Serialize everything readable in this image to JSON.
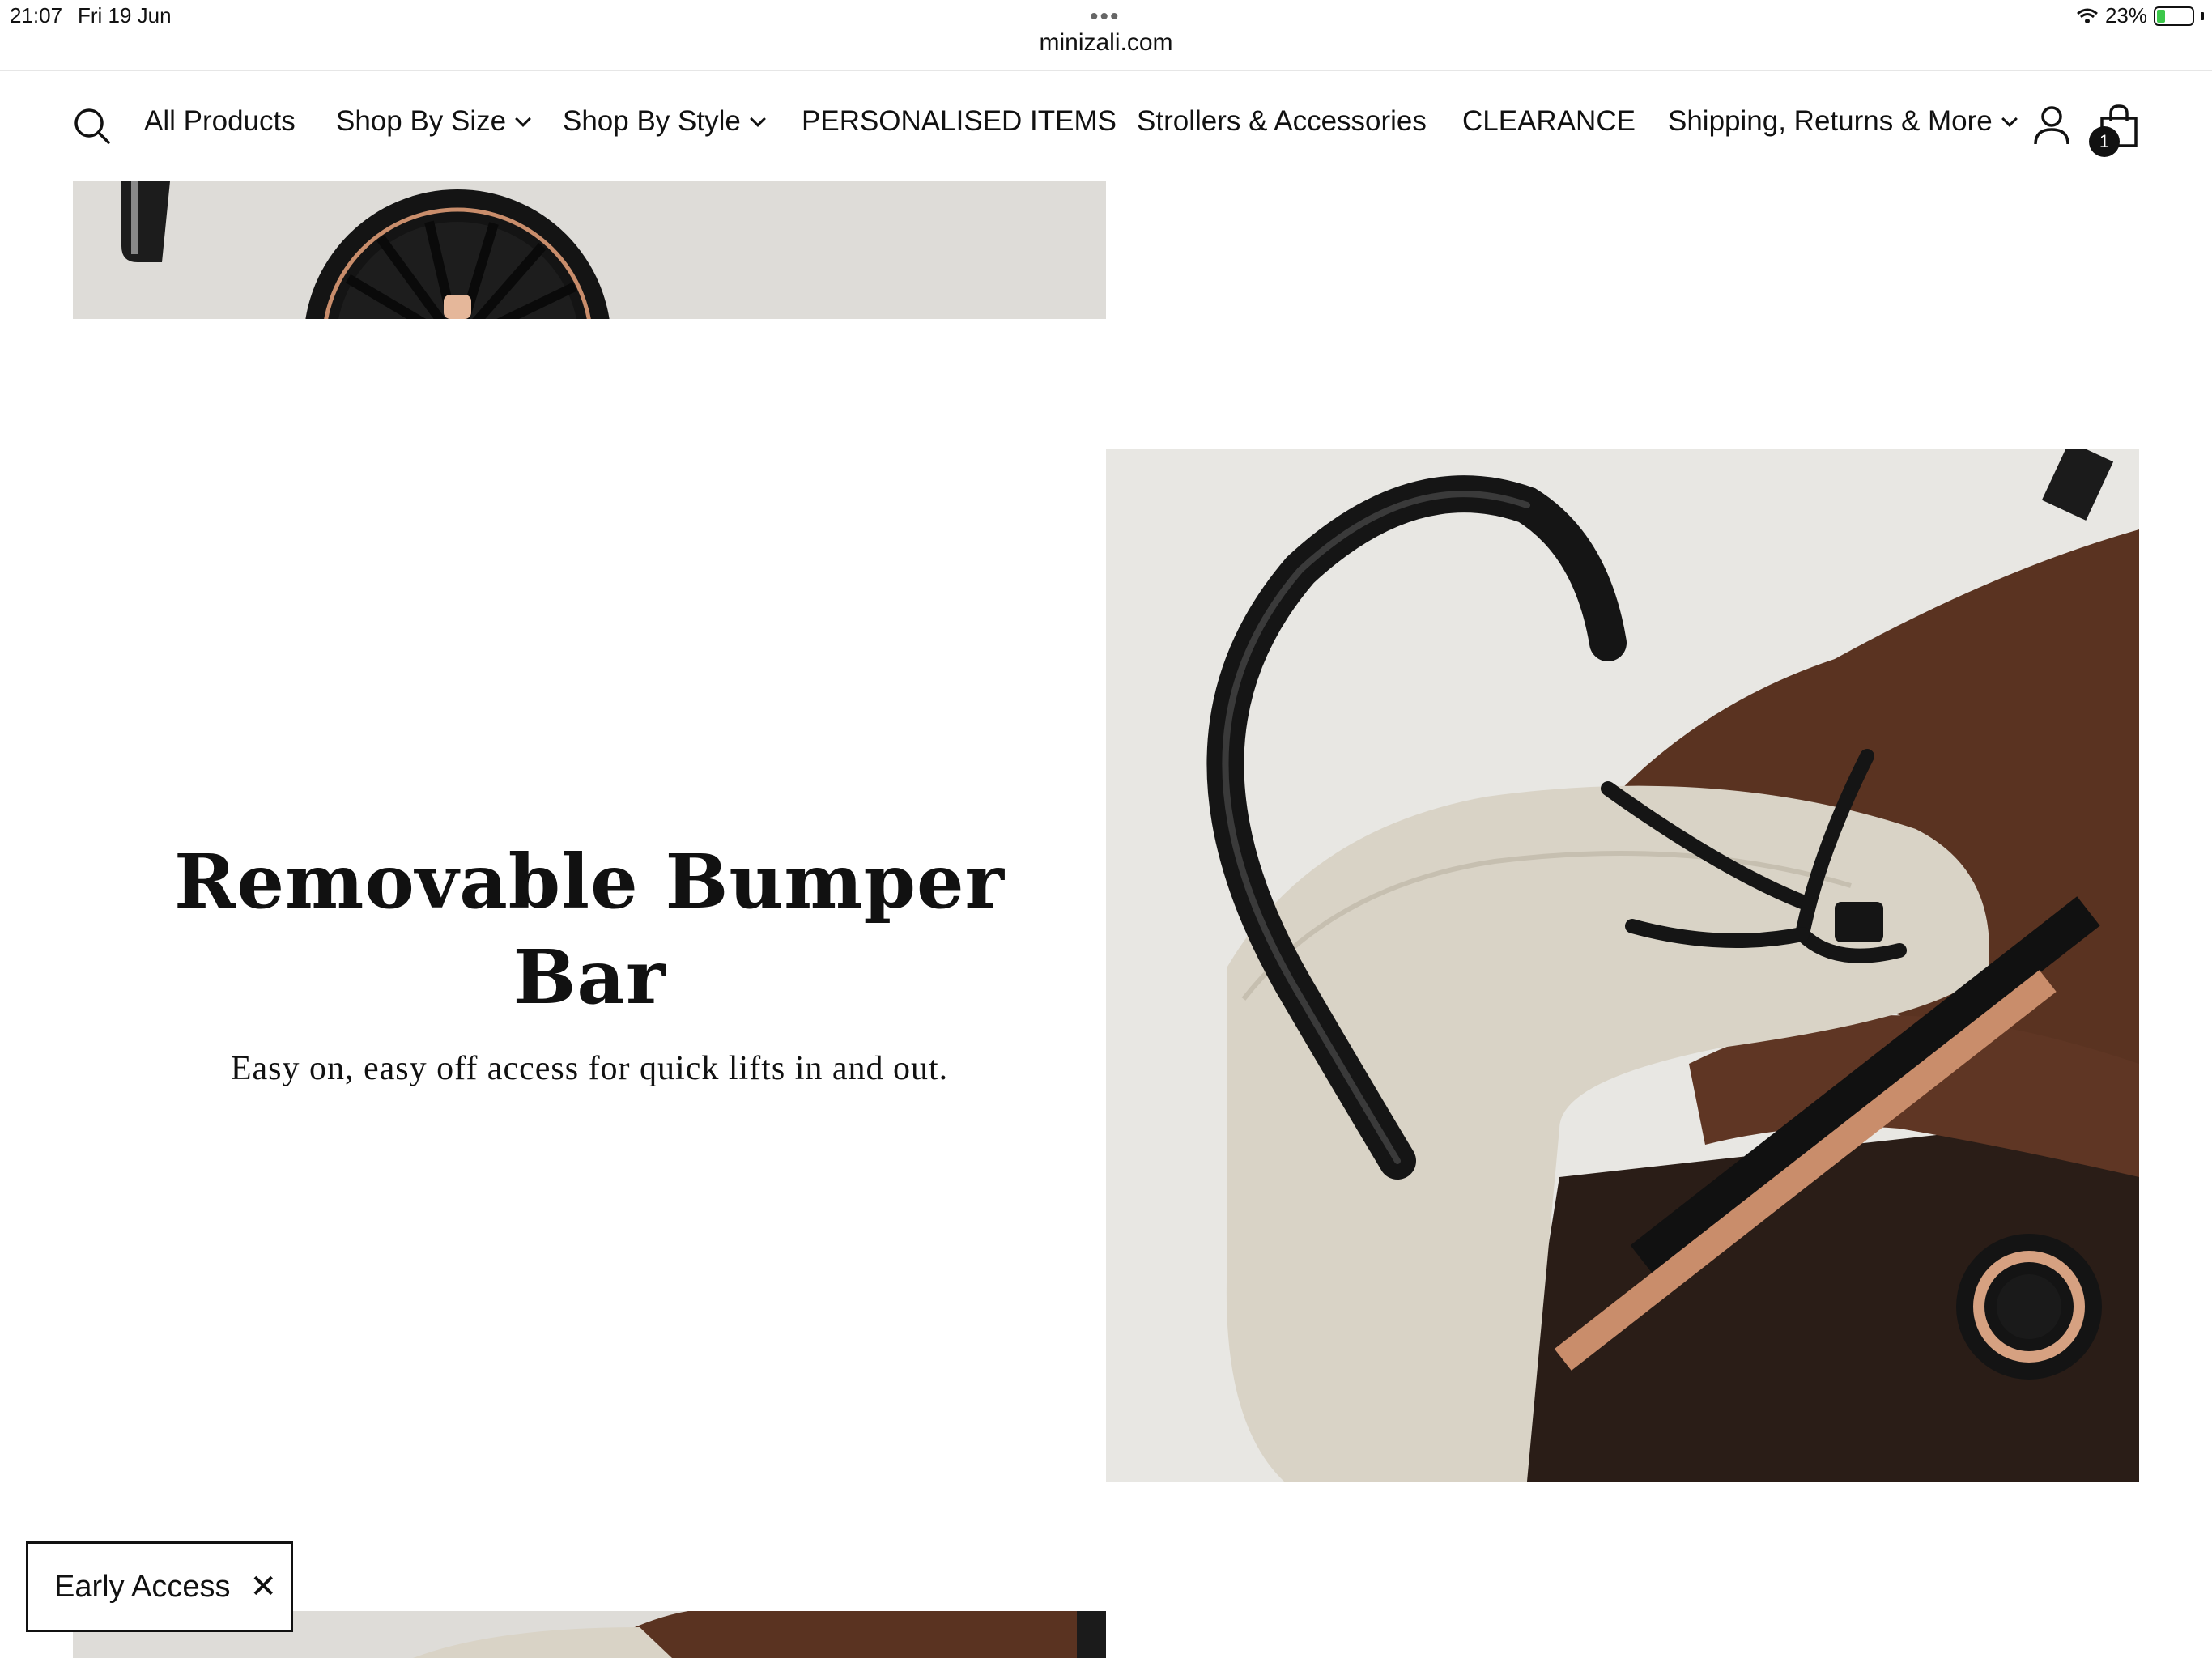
{
  "status_bar": {
    "time": "21:07",
    "date": "Fri 19 Jun",
    "url": "minizali.com",
    "battery": "23%"
  },
  "nav": {
    "items": [
      {
        "label": "All Products"
      },
      {
        "label": "Shop By Size"
      },
      {
        "label": "Shop By Style"
      },
      {
        "label": "PERSONALISED ITEMS"
      },
      {
        "label": "Strollers & Accessories"
      },
      {
        "label": "CLEARANCE"
      },
      {
        "label": "Shipping, Returns & More"
      }
    ],
    "cart_count": "1"
  },
  "feature": {
    "title": "Removable Bumper Bar",
    "subtitle": "Easy on, easy off access for quick lifts in and out."
  },
  "popup": {
    "label": "Early Access"
  },
  "colors": {
    "brown": "#5b3422",
    "cream": "#d8d2c5",
    "rose_gold": "#c98d6b",
    "black": "#111111"
  }
}
